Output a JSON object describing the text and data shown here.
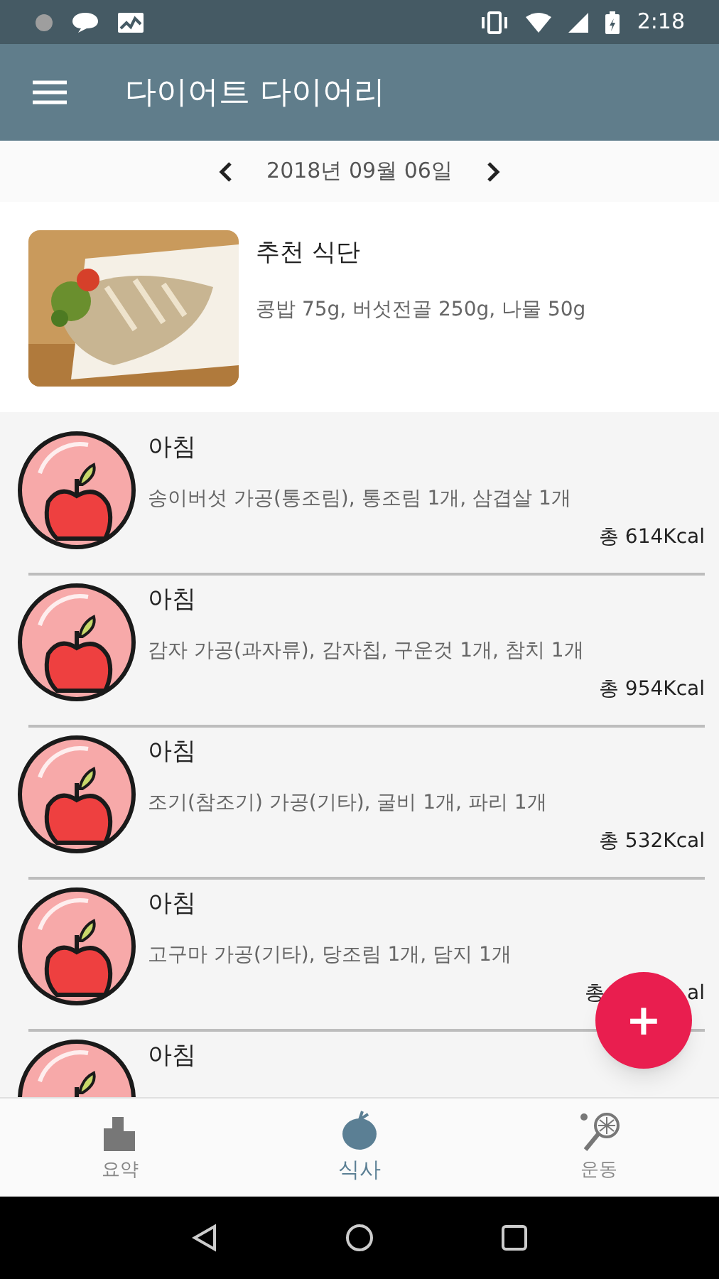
{
  "status_bar": {
    "time": "2:18"
  },
  "app_bar": {
    "title": "다이어트 다이어리"
  },
  "date_nav": {
    "date": "2018년 09월 06일"
  },
  "recommended": {
    "title": "추천 식단",
    "foods": "콩밥 75g, 버섯전골 250g, 나물 50g"
  },
  "meals": [
    {
      "title": "아침",
      "foods": "송이버섯 가공(통조림), 통조림  1개, 삼겹살 1개",
      "total_parts": [
        "총 614Kcal"
      ]
    },
    {
      "title": "아침",
      "foods": "감자 가공(과자류), 감자칩, 구운것  1개, 참치 1개",
      "total_parts": [
        "총 954Kcal"
      ]
    },
    {
      "title": "아침",
      "foods": "조기(참조기) 가공(기타), 굴비  1개, 파리 1개",
      "total_parts": [
        "총 532Kcal"
      ]
    },
    {
      "title": "아침",
      "foods": "고구마 가공(기타), 당조림  1개, 담지 1개",
      "total_parts": [
        "총",
        "al"
      ]
    },
    {
      "title": "아침"
    }
  ],
  "fab": {
    "label": "+"
  },
  "bottom_nav": [
    {
      "kind": "summary",
      "label": "요약",
      "selected": false
    },
    {
      "kind": "meal",
      "label": "식사",
      "selected": true
    },
    {
      "kind": "exercise",
      "label": "운동",
      "selected": false
    }
  ]
}
